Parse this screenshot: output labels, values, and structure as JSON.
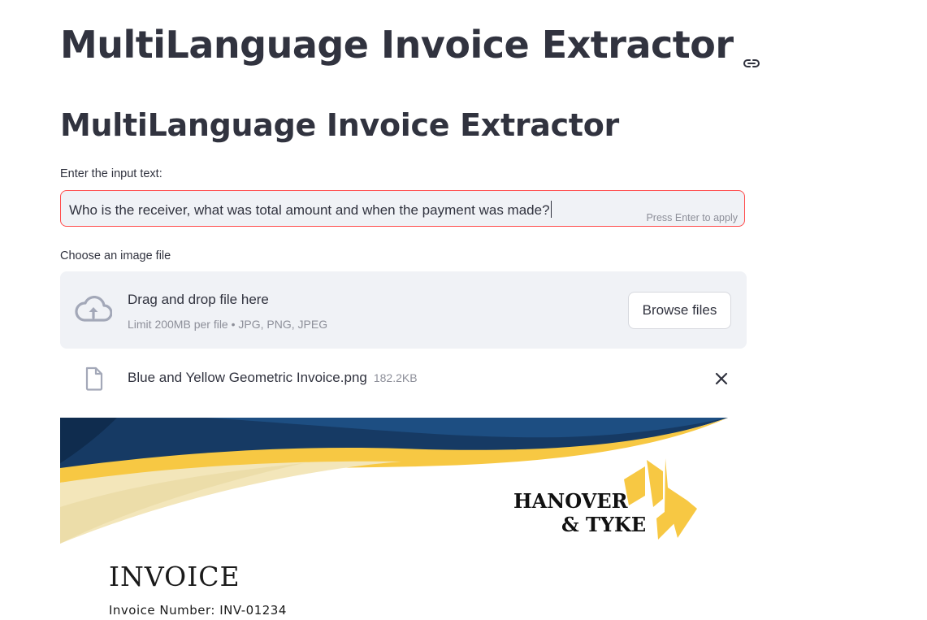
{
  "page": {
    "title": "MultiLanguage Invoice Extractor",
    "subtitle": "MultiLanguage Invoice Extractor"
  },
  "input": {
    "label": "Enter the input text:",
    "value": "Who is the receiver, what was total amount and when the payment was made?",
    "hint": "Press Enter to apply"
  },
  "uploader": {
    "label": "Choose an image file",
    "drop_title": "Drag and drop file here",
    "drop_limit": "Limit 200MB per file • JPG, PNG, JPEG",
    "browse_label": "Browse files",
    "file": {
      "name": "Blue and Yellow Geometric Invoice.png",
      "size": "182.2KB"
    }
  },
  "invoice_preview": {
    "brand_line1": "HANOVER",
    "brand_line2": "& TYKE",
    "title": "INVOICE",
    "number": "Invoice Number: INV-01234"
  },
  "colors": {
    "accent_error": "#ff4b4b",
    "input_bg": "#f0f2f6",
    "text": "#31333f",
    "muted": "#8d8f99",
    "invoice_navy": "#163a64",
    "invoice_yellow": "#f7c843"
  },
  "icons": {
    "heading_anchor": "link-icon",
    "upload": "cloud-upload-icon",
    "file": "file-icon",
    "remove": "close-icon"
  }
}
